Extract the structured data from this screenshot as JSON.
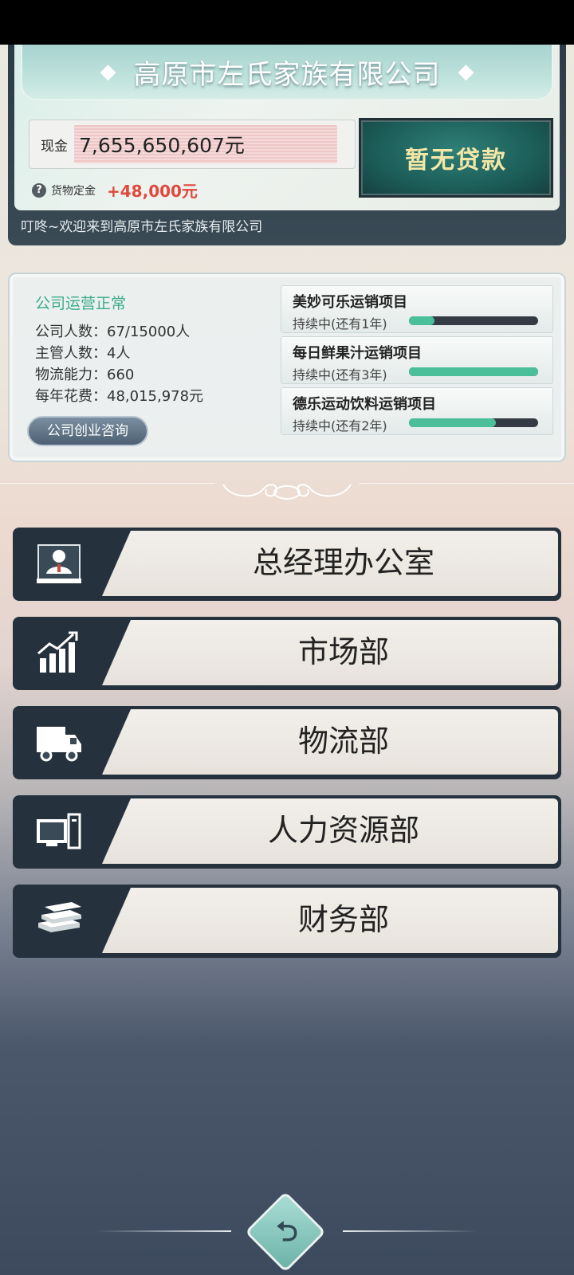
{
  "header": {
    "company_name": "高原市左氏家族有限公司",
    "cash_label": "现金",
    "cash_value": "7,655,650,607元",
    "deposit_label": "货物定金",
    "deposit_value": "+48,000元",
    "loan_button": "暂无贷款",
    "welcome_message": "叮咚~欢迎来到高原市左氏家族有限公司"
  },
  "operations": {
    "status": "公司运营正常",
    "stats": [
      "公司人数：67/15000人",
      "主管人数：4人",
      "物流能力：660",
      "每年花费：48,015,978元"
    ],
    "consult_button": "公司创业咨询",
    "projects": [
      {
        "name": "美妙可乐运销项目",
        "status": "持续中(还有1年)",
        "progress": 0.2
      },
      {
        "name": "每日鲜果汁运销项目",
        "status": "持续中(还有3年)",
        "progress": 1.0
      },
      {
        "name": "德乐运动饮料运销项目",
        "status": "持续中(还有2年)",
        "progress": 0.67
      }
    ]
  },
  "departments": [
    {
      "label": "总经理办公室",
      "icon": "manager-office-icon"
    },
    {
      "label": "市场部",
      "icon": "growth-chart-icon"
    },
    {
      "label": "物流部",
      "icon": "truck-icon"
    },
    {
      "label": "人力资源部",
      "icon": "computer-icon"
    },
    {
      "label": "财务部",
      "icon": "cash-stack-icon"
    }
  ],
  "colors": {
    "status_green": "#3cab8b",
    "deposit_red": "#e0493d",
    "loan_text": "#f2e7a7",
    "progress_fill": "#4bbf9a"
  }
}
